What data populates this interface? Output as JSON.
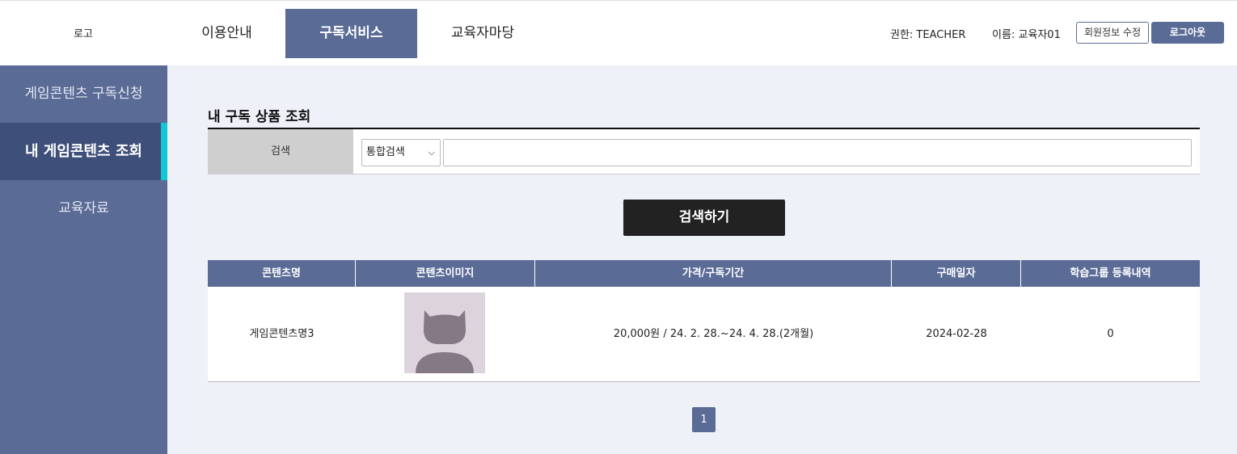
{
  "header": {
    "logo": "로고",
    "nav": [
      {
        "label": "이용안내"
      },
      {
        "label": "구독서비스"
      },
      {
        "label": "교육자마당"
      }
    ],
    "role_text": "권한: TEACHER",
    "name_text": "이름: 교육자01",
    "edit_label": "회원정보 수정",
    "logout_label": "로그아웃"
  },
  "sidebar": {
    "items": [
      {
        "label": "게임콘텐츠 구독신청"
      },
      {
        "label": "내 게임콘텐츠 조회"
      },
      {
        "label": "교육자료"
      }
    ]
  },
  "main": {
    "title": "내 구독 상품 조회",
    "search": {
      "label": "검색",
      "select_value": "통합검색",
      "input_value": "",
      "button_label": "검색하기"
    },
    "table": {
      "headers": [
        "콘텐츠명",
        "콘텐츠이미지",
        "가격/구독기간",
        "구매일자",
        "학습그룹 등록내역"
      ],
      "rows": [
        {
          "name": "게임콘텐츠명3",
          "price_period": "20,000원 / 24. 2. 28.~24. 4. 28.(2개월)",
          "date": "2024-02-28",
          "groups": "0"
        }
      ]
    },
    "pagination": {
      "current": "1"
    }
  },
  "colors": {
    "primary": "#5a6b96",
    "sidebar_active": "#3e4f7a",
    "accent": "#12c7d6",
    "background": "#eef1f8"
  }
}
